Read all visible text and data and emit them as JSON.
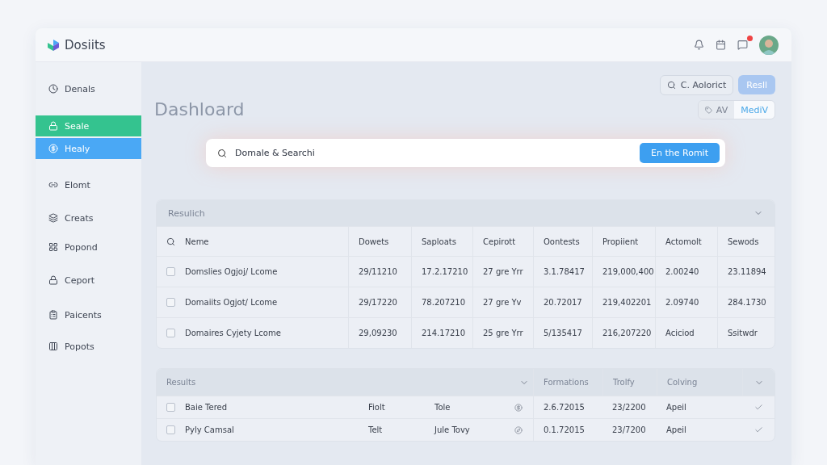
{
  "app": {
    "name": "Dosiits",
    "notification": true
  },
  "sidebar": {
    "items": [
      {
        "label": "Denals",
        "selected": false
      },
      {
        "label": "Seale",
        "selected": true,
        "color": "#34c38f"
      },
      {
        "label": "Healy",
        "selected": true,
        "color": "#4aa8f5"
      },
      {
        "label": "Elomt",
        "selected": false
      },
      {
        "label": "Creats",
        "selected": false
      },
      {
        "label": "Popond",
        "selected": false
      },
      {
        "label": "Ceport",
        "selected": false
      },
      {
        "label": "Paicents",
        "selected": false
      },
      {
        "label": "Popots",
        "selected": false
      }
    ]
  },
  "page_title": "Dashloard",
  "actions": {
    "search_button": "C. Aolorict",
    "primary_button": "Resll"
  },
  "segments": [
    {
      "label": "AV",
      "selected": false
    },
    {
      "label": "MediV",
      "selected": true
    }
  ],
  "search": {
    "value": "Domale & Searchi",
    "button": "En the Romit"
  },
  "table_1": {
    "title": "Resulich",
    "columns": [
      "Neme",
      "Dowets",
      "Saploats",
      "Cepirott",
      "Oontests",
      "Propiient",
      "Actomolt",
      "Sewods"
    ],
    "rows": [
      {
        "checked": false,
        "cells": [
          "Domslies Ogjoj/ Lcome",
          "29/11210",
          "17.2.17210",
          "27 gre Yrr",
          "3.1.78417",
          "219,000,400",
          "2.00240",
          "23.11894"
        ]
      },
      {
        "checked": false,
        "cells": [
          "Domaiits Ogjot/ Lcome",
          "29/17220",
          "78.207210",
          "27 gre Yv",
          "20.72017",
          "219,402201",
          "2.09740",
          "284.1730"
        ]
      },
      {
        "checked": false,
        "cells": [
          "Domaires Cyjety Lcome",
          "29,09230",
          "214.17210",
          "25 gre Yrr",
          "5/135417",
          "216,207220",
          "Aciciod",
          "Ssitwdr"
        ]
      }
    ]
  },
  "table_2": {
    "title": "Results",
    "group_headers": [
      "Formations",
      "Trolfy",
      "Colving"
    ],
    "rows": [
      {
        "checked": false,
        "cells": [
          "Baie Tered",
          "Fiolt",
          "Tole",
          "2.6.72015",
          "23/2200",
          "Apeil"
        ]
      },
      {
        "checked": false,
        "cells": [
          "Pyly Camsal",
          "Telt",
          "Jule Tovy",
          "0.1.72015",
          "23/7200",
          "Apeil"
        ]
      }
    ]
  }
}
